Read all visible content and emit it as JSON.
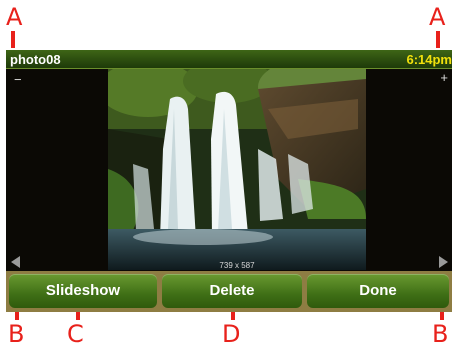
{
  "callouts": {
    "top_left": "A",
    "top_right": "A",
    "bottom_left": "B",
    "bottom_second": "C",
    "bottom_middle": "D",
    "bottom_right": "B"
  },
  "header": {
    "title": "photo08",
    "time": "6:14pm"
  },
  "viewer": {
    "zoom_out": "−",
    "zoom_in": "+",
    "dimensions": "739 x 587"
  },
  "buttons": {
    "slideshow": "Slideshow",
    "delete": "Delete",
    "done": "Done"
  },
  "colors": {
    "callout": "#e8211b",
    "header_bg": "#2c4d0f",
    "clock": "#f1e00c",
    "button_bg": "#4d7d1e",
    "button_bar": "#8e7d43"
  }
}
